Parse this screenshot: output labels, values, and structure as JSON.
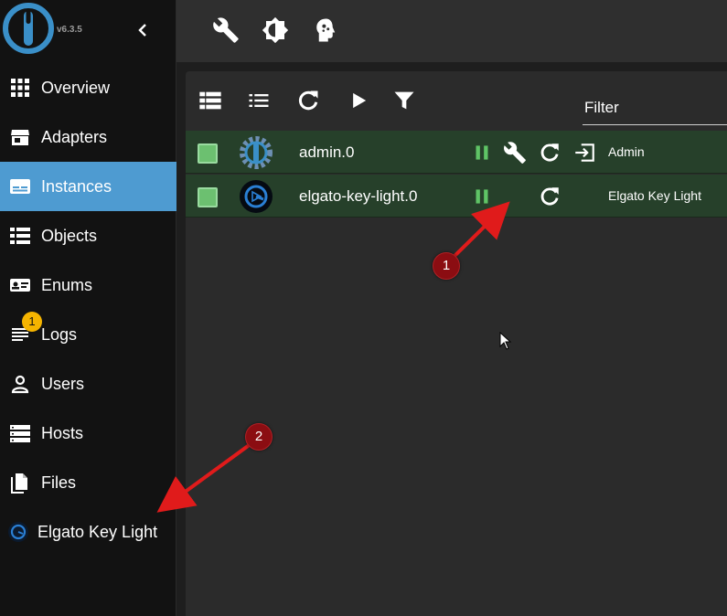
{
  "app": {
    "version": "v6.3.5",
    "accent_color": "#4e9bd1",
    "active_row_color": "#26402a",
    "badge_color": "#f5b400"
  },
  "sidebar": {
    "items": [
      {
        "label": "Overview",
        "icon": "grid-icon"
      },
      {
        "label": "Adapters",
        "icon": "store-icon"
      },
      {
        "label": "Instances",
        "icon": "instances-icon",
        "active": true
      },
      {
        "label": "Objects",
        "icon": "list-icon"
      },
      {
        "label": "Enums",
        "icon": "enum-card-icon"
      },
      {
        "label": "Logs",
        "icon": "log-lines-icon",
        "badge": "1"
      },
      {
        "label": "Users",
        "icon": "user-icon"
      },
      {
        "label": "Hosts",
        "icon": "server-icon"
      },
      {
        "label": "Files",
        "icon": "files-icon"
      },
      {
        "label": "Elgato Key Light",
        "icon": "elgato-icon"
      }
    ]
  },
  "topbar": {
    "icons": [
      "wrench-icon",
      "brightness-icon",
      "expert-mode-icon"
    ]
  },
  "instances": {
    "toolbar_icons": [
      "table-view-icon",
      "list-view-icon",
      "refresh-icon",
      "play-icon",
      "filter-icon"
    ],
    "filter_label": "Filter",
    "rows": [
      {
        "name": "admin.0",
        "title": "Admin",
        "actions": [
          "pause-icon",
          "wrench-icon",
          "restart-icon",
          "open-link-icon"
        ]
      },
      {
        "name": "elgato-key-light.0",
        "title": "Elgato Key Light",
        "actions": [
          "pause-icon",
          "restart-icon"
        ]
      }
    ]
  },
  "annotations": {
    "marker_1": "1",
    "marker_2": "2"
  }
}
